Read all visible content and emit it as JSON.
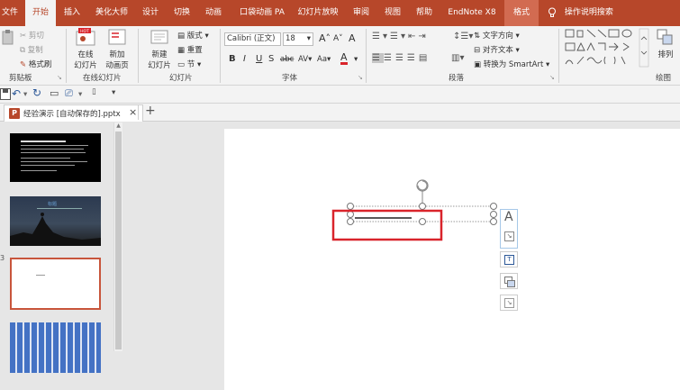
{
  "tabs": [
    {
      "label": "文件"
    },
    {
      "label": "开始"
    },
    {
      "label": "插入"
    },
    {
      "label": "美化大师"
    },
    {
      "label": "设计"
    },
    {
      "label": "切换"
    },
    {
      "label": "动画"
    },
    {
      "label": "口袋动画 PA"
    },
    {
      "label": "幻灯片放映"
    },
    {
      "label": "审阅"
    },
    {
      "label": "视图"
    },
    {
      "label": "帮助"
    },
    {
      "label": "EndNote X8"
    },
    {
      "label": "格式"
    },
    {
      "label": "操作说明搜索"
    }
  ],
  "ribbon": {
    "clipboard": {
      "cut": "剪切",
      "copy": "复制",
      "format_painter": "格式刷",
      "label": "剪贴板"
    },
    "online": {
      "btn1": "在线",
      "btn1b": "幻灯片",
      "btn2": "新加",
      "btn2b": "动画页",
      "label": "在线幻灯片",
      "hot": "HOT"
    },
    "slides": {
      "new1": "新建",
      "new2": "幻灯片",
      "layout": "版式",
      "reset": "重置",
      "section": "节",
      "label": "幻灯片"
    },
    "font": {
      "name": "Calibri (正文)",
      "size": "18",
      "grow": "A",
      "shrink": "A",
      "bold": "B",
      "italic": "I",
      "underline": "U",
      "shadow": "S",
      "strike": "abc",
      "spacing": "AV",
      "case": "Aa",
      "color": "A",
      "label": "字体"
    },
    "paragraph": {
      "direction": "文字方向",
      "align": "对齐文本",
      "smartart": "转换为 SmartArt",
      "label": "段落"
    },
    "drawing": {
      "arrange": "排列",
      "label": "绘图"
    }
  },
  "qat": {
    "save": "save",
    "undo": "undo",
    "redo": "redo"
  },
  "doc": {
    "tab_title": "经验演示 [自动保存的].pptx",
    "close": "×",
    "add": "+"
  },
  "slide_numbers": [
    "",
    "",
    "3",
    ""
  ],
  "slide1_lines": 8,
  "slide2_title": "标题",
  "colors": {
    "accent": "#b7472a",
    "selection_red": "#d9242b",
    "thumb_blue": "#4472c4"
  }
}
